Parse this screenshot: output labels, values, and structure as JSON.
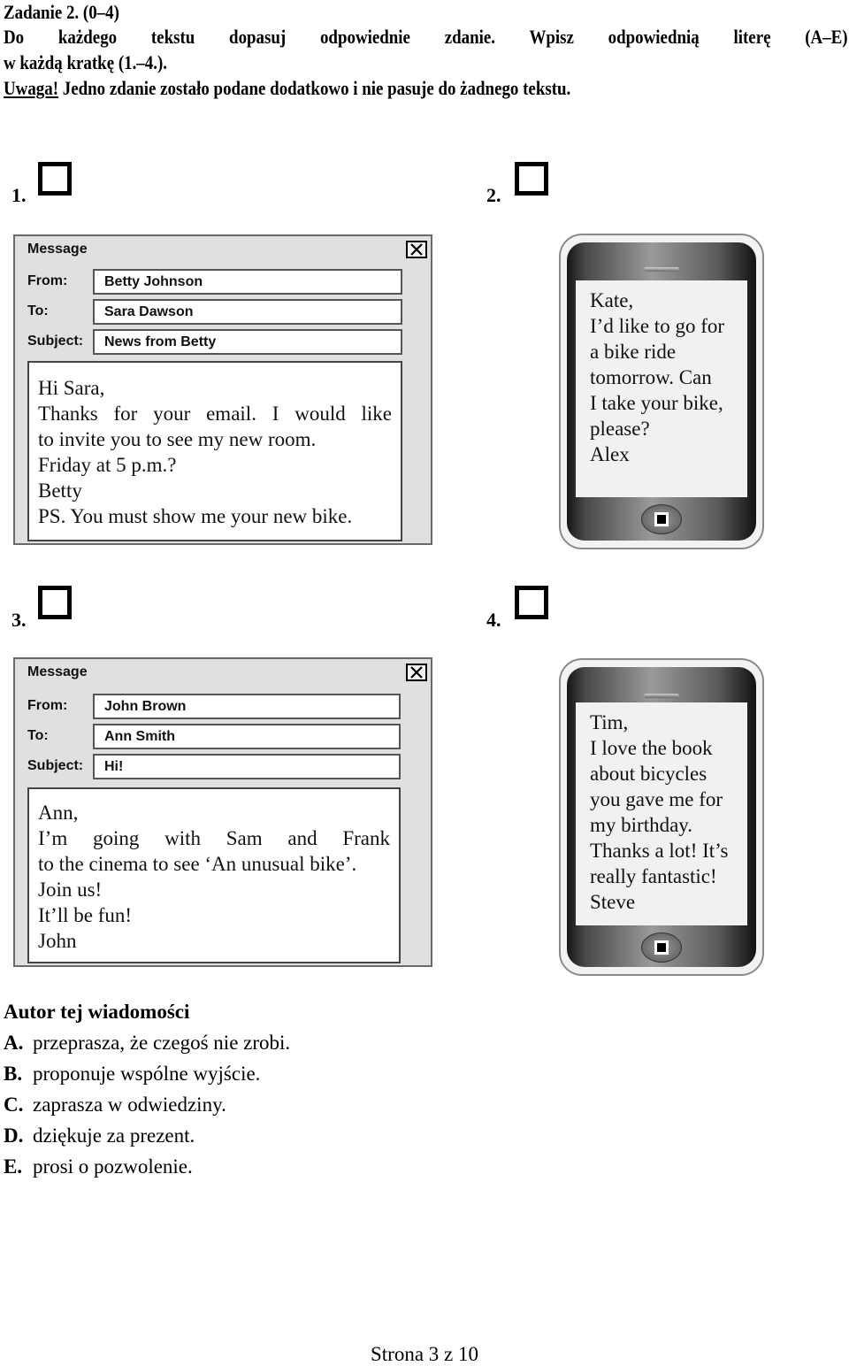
{
  "header": {
    "task_title": "Zadanie 2. (0–4)",
    "instruction_line1": "Do każdego tekstu dopasuj odpowiednie zdanie. Wpisz odpowiednią literę (A–E)",
    "instruction_line2": "w każdą kratkę (1.–4.).",
    "note_label": "Uwaga!",
    "note_text": " Jedno zdanie zostało podane dodatkowo i nie pasuje do żadnego tekstu."
  },
  "items": [
    {
      "number": "1.",
      "type": "email",
      "window_title": "Message",
      "from_label": "From:",
      "to_label": "To:",
      "subject_label": "Subject:",
      "from": "Betty Johnson",
      "to": "Sara Dawson",
      "subject": "News from Betty",
      "body": [
        "Hi Sara,",
        "Thanks for your email. I would like",
        "to invite you to see my new room.",
        "Friday at 5 p.m.?",
        "Betty",
        "PS. You must show me your new bike."
      ]
    },
    {
      "number": "2.",
      "type": "sms",
      "body": [
        "Kate,",
        "I’d like to go for",
        "a bike ride",
        "tomorrow. Can",
        "I take your bike,",
        "please?",
        "Alex"
      ]
    },
    {
      "number": "3.",
      "type": "email",
      "window_title": "Message",
      "from_label": "From:",
      "to_label": "To:",
      "subject_label": "Subject:",
      "from": "John Brown",
      "to": "Ann Smith",
      "subject": "Hi!",
      "body": [
        "Ann,",
        "I’m going with Sam and Frank",
        "to the cinema to see ‘An unusual bike’.",
        "Join us!",
        "It’ll be fun!",
        "John"
      ]
    },
    {
      "number": "4.",
      "type": "sms",
      "body": [
        "Tim,",
        "I love the book",
        "about bicycles",
        "you gave me for",
        "my birthday.",
        "Thanks a lot! It’s",
        "really fantastic!",
        "Steve"
      ]
    }
  ],
  "options": {
    "title": "Autor tej wiadomości",
    "list": [
      {
        "letter": "A.",
        "text": "przeprasza, że czegoś nie zrobi."
      },
      {
        "letter": "B.",
        "text": "proponuje wspólne wyjście."
      },
      {
        "letter": "C.",
        "text": "zaprasza w odwiedziny."
      },
      {
        "letter": "D.",
        "text": "dziękuje za prezent."
      },
      {
        "letter": "E.",
        "text": "prosi o pozwolenie."
      }
    ]
  },
  "footer": {
    "page": "Strona 3 z 10"
  }
}
